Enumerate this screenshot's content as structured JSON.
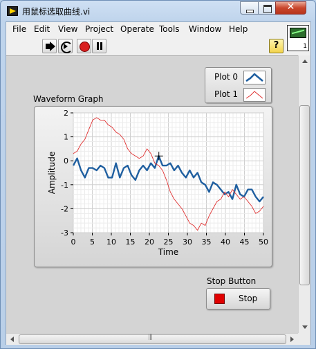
{
  "window": {
    "title": "用鼠标选取曲线.vi"
  },
  "caption_buttons": {
    "close": "✕"
  },
  "menu": [
    {
      "label": "File",
      "name": "menu-file"
    },
    {
      "label": "Edit",
      "name": "menu-edit"
    },
    {
      "label": "View",
      "name": "menu-view"
    },
    {
      "label": "Project",
      "name": "menu-project"
    },
    {
      "label": "Operate",
      "name": "menu-operate"
    },
    {
      "label": "Tools",
      "name": "menu-tools"
    },
    {
      "label": "Window",
      "name": "menu-window"
    },
    {
      "label": "Help",
      "name": "menu-help"
    }
  ],
  "toolbar": {
    "icons": [
      "run-icon",
      "run-continuously-icon",
      "abort-icon",
      "pause-icon",
      "context-help-icon"
    ],
    "help_label": "?"
  },
  "vi_icon": {
    "number": "1"
  },
  "legend": {
    "items": [
      {
        "label": "Plot 0",
        "color": "#1f5fa0",
        "style": "thick"
      },
      {
        "label": "Plot 1",
        "color": "#e03030",
        "style": "thin"
      }
    ]
  },
  "graph": {
    "label": "Waveform Graph"
  },
  "chart_data": {
    "type": "line",
    "xlabel": "Time",
    "ylabel": "Amplitude",
    "xlim": [
      0,
      50
    ],
    "ylim": [
      -3,
      2
    ],
    "x_ticks": [
      "0",
      "5",
      "10",
      "15",
      "20",
      "25",
      "30",
      "35",
      "40",
      "45",
      "50"
    ],
    "y_ticks": [
      "2",
      "1",
      "0",
      "-1",
      "-2",
      "-3"
    ],
    "grid": true,
    "cursor": {
      "x": 22.5,
      "y": 0.2
    },
    "series": [
      {
        "name": "Plot 0",
        "color": "#1f5fa0",
        "values": [
          -0.2,
          0.1,
          -0.4,
          -0.7,
          -0.3,
          -0.3,
          -0.4,
          -0.2,
          -0.3,
          -0.7,
          -0.7,
          -0.1,
          -0.7,
          -0.3,
          -0.2,
          -0.6,
          -0.8,
          -0.4,
          -0.2,
          -0.4,
          -0.1,
          -0.3,
          0.2,
          -0.2,
          -0.2,
          -0.1,
          -0.4,
          -0.2,
          -0.5,
          -0.7,
          -0.4,
          -0.7,
          -0.5,
          -0.9,
          -1.0,
          -1.3,
          -0.9,
          -1.0,
          -1.2,
          -1.4,
          -1.3,
          -1.6,
          -1.0,
          -1.4,
          -1.5,
          -1.2,
          -1.2,
          -1.5,
          -1.7,
          -1.5
        ]
      },
      {
        "name": "Plot 1",
        "color": "#e03030",
        "values": [
          0.3,
          0.4,
          0.7,
          0.9,
          1.3,
          1.7,
          1.8,
          1.7,
          1.7,
          1.5,
          1.4,
          1.2,
          1.1,
          0.9,
          0.5,
          0.3,
          0.2,
          0.1,
          0.2,
          0.5,
          0.3,
          -0.1,
          -0.2,
          -0.4,
          -0.8,
          -1.3,
          -1.6,
          -1.8,
          -2.0,
          -2.3,
          -2.6,
          -2.7,
          -2.9,
          -2.6,
          -2.7,
          -2.3,
          -2.0,
          -1.7,
          -1.6,
          -1.3,
          -1.5,
          -1.2,
          -1.4,
          -1.6,
          -1.5,
          -1.7,
          -1.9,
          -2.2,
          -2.1,
          -1.9
        ]
      }
    ]
  },
  "stop_button": {
    "label": "Stop Button",
    "text": "Stop"
  }
}
